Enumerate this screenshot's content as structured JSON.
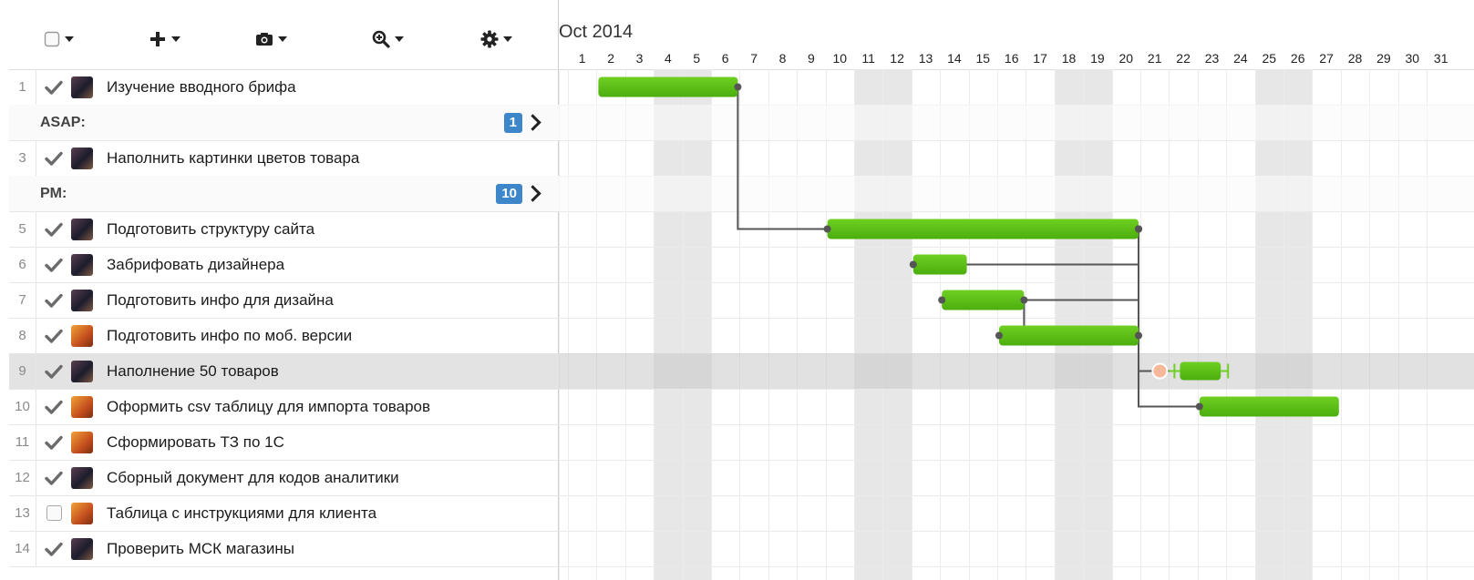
{
  "toolbar": {
    "items": [
      {
        "icon": "checkbox-icon",
        "has_menu": true
      },
      {
        "icon": "plus-icon",
        "has_menu": true
      },
      {
        "icon": "camera-icon",
        "has_menu": true
      },
      {
        "icon": "zoom-icon",
        "has_menu": true
      },
      {
        "icon": "gear-icon",
        "has_menu": true
      }
    ]
  },
  "timeline": {
    "month_label": "Oct 2014",
    "days": [
      "1",
      "2",
      "3",
      "4",
      "5",
      "6",
      "7",
      "8",
      "9",
      "10",
      "11",
      "12",
      "13",
      "14",
      "15",
      "16",
      "17",
      "18",
      "19",
      "20",
      "21",
      "22",
      "23",
      "24",
      "25",
      "26",
      "27",
      "28",
      "29",
      "30",
      "31"
    ],
    "weekend_days": [
      4,
      5,
      11,
      12,
      18,
      19,
      25,
      26
    ]
  },
  "rows": [
    {
      "type": "task",
      "num": "1",
      "done": true,
      "avatar": "dark",
      "name": "Изучение вводного брифа"
    },
    {
      "type": "group",
      "title": "ASAP:",
      "count": "1"
    },
    {
      "type": "task",
      "num": "3",
      "done": true,
      "avatar": "dark",
      "name": "Наполнить картинки цветов товара"
    },
    {
      "type": "group",
      "title": "PM:",
      "count": "10"
    },
    {
      "type": "task",
      "num": "5",
      "done": true,
      "avatar": "dark",
      "name": "Подготовить структуру сайта"
    },
    {
      "type": "task",
      "num": "6",
      "done": true,
      "avatar": "dark",
      "name": "Забрифовать дизайнера"
    },
    {
      "type": "task",
      "num": "7",
      "done": true,
      "avatar": "dark",
      "name": "Подготовить инфо для дизайна"
    },
    {
      "type": "task",
      "num": "8",
      "done": true,
      "avatar": "orange",
      "name": "Подготовить инфо по моб. версии"
    },
    {
      "type": "task",
      "num": "9",
      "done": true,
      "avatar": "dark",
      "name": "Наполнение 50 товаров",
      "selected": true
    },
    {
      "type": "task",
      "num": "10",
      "done": true,
      "avatar": "orange",
      "name": "Оформить csv таблицу для импорта товаров"
    },
    {
      "type": "task",
      "num": "11",
      "done": true,
      "avatar": "orange",
      "name": "Сформировать ТЗ по 1С"
    },
    {
      "type": "task",
      "num": "12",
      "done": true,
      "avatar": "dark",
      "name": "Сборный документ для кодов аналитики"
    },
    {
      "type": "task",
      "num": "13",
      "done": false,
      "avatar": "orange",
      "name": "Таблица с инструкциями для клиента"
    },
    {
      "type": "task",
      "num": "14",
      "done": true,
      "avatar": "dark",
      "name": "Проверить МСК магазины"
    }
  ],
  "bars": [
    {
      "row": 0,
      "start": 2,
      "end": 6
    },
    {
      "row": 4,
      "start": 10,
      "end": 20
    },
    {
      "row": 5,
      "start": 13,
      "end": 14
    },
    {
      "row": 6,
      "start": 14,
      "end": 16
    },
    {
      "row": 7,
      "start": 16,
      "end": 20
    },
    {
      "row": 8,
      "start": 22,
      "end": 23,
      "editing": true
    },
    {
      "row": 9,
      "start": 23,
      "end": 27
    }
  ],
  "links": [
    {
      "from": 0,
      "to": 1
    },
    {
      "from": 1,
      "to": 2
    },
    {
      "from": 1,
      "to": 3
    },
    {
      "from": 3,
      "to": 4
    },
    {
      "from": 1,
      "to": 5
    },
    {
      "from": 4,
      "to": 6
    }
  ],
  "colors": {
    "bar": "#4cae0e",
    "bar_light": "#6fcf22",
    "link": "#555555",
    "badge": "#3d86c9",
    "weekend": "#e7e7e7",
    "drag_handle": "#f6b79a"
  }
}
